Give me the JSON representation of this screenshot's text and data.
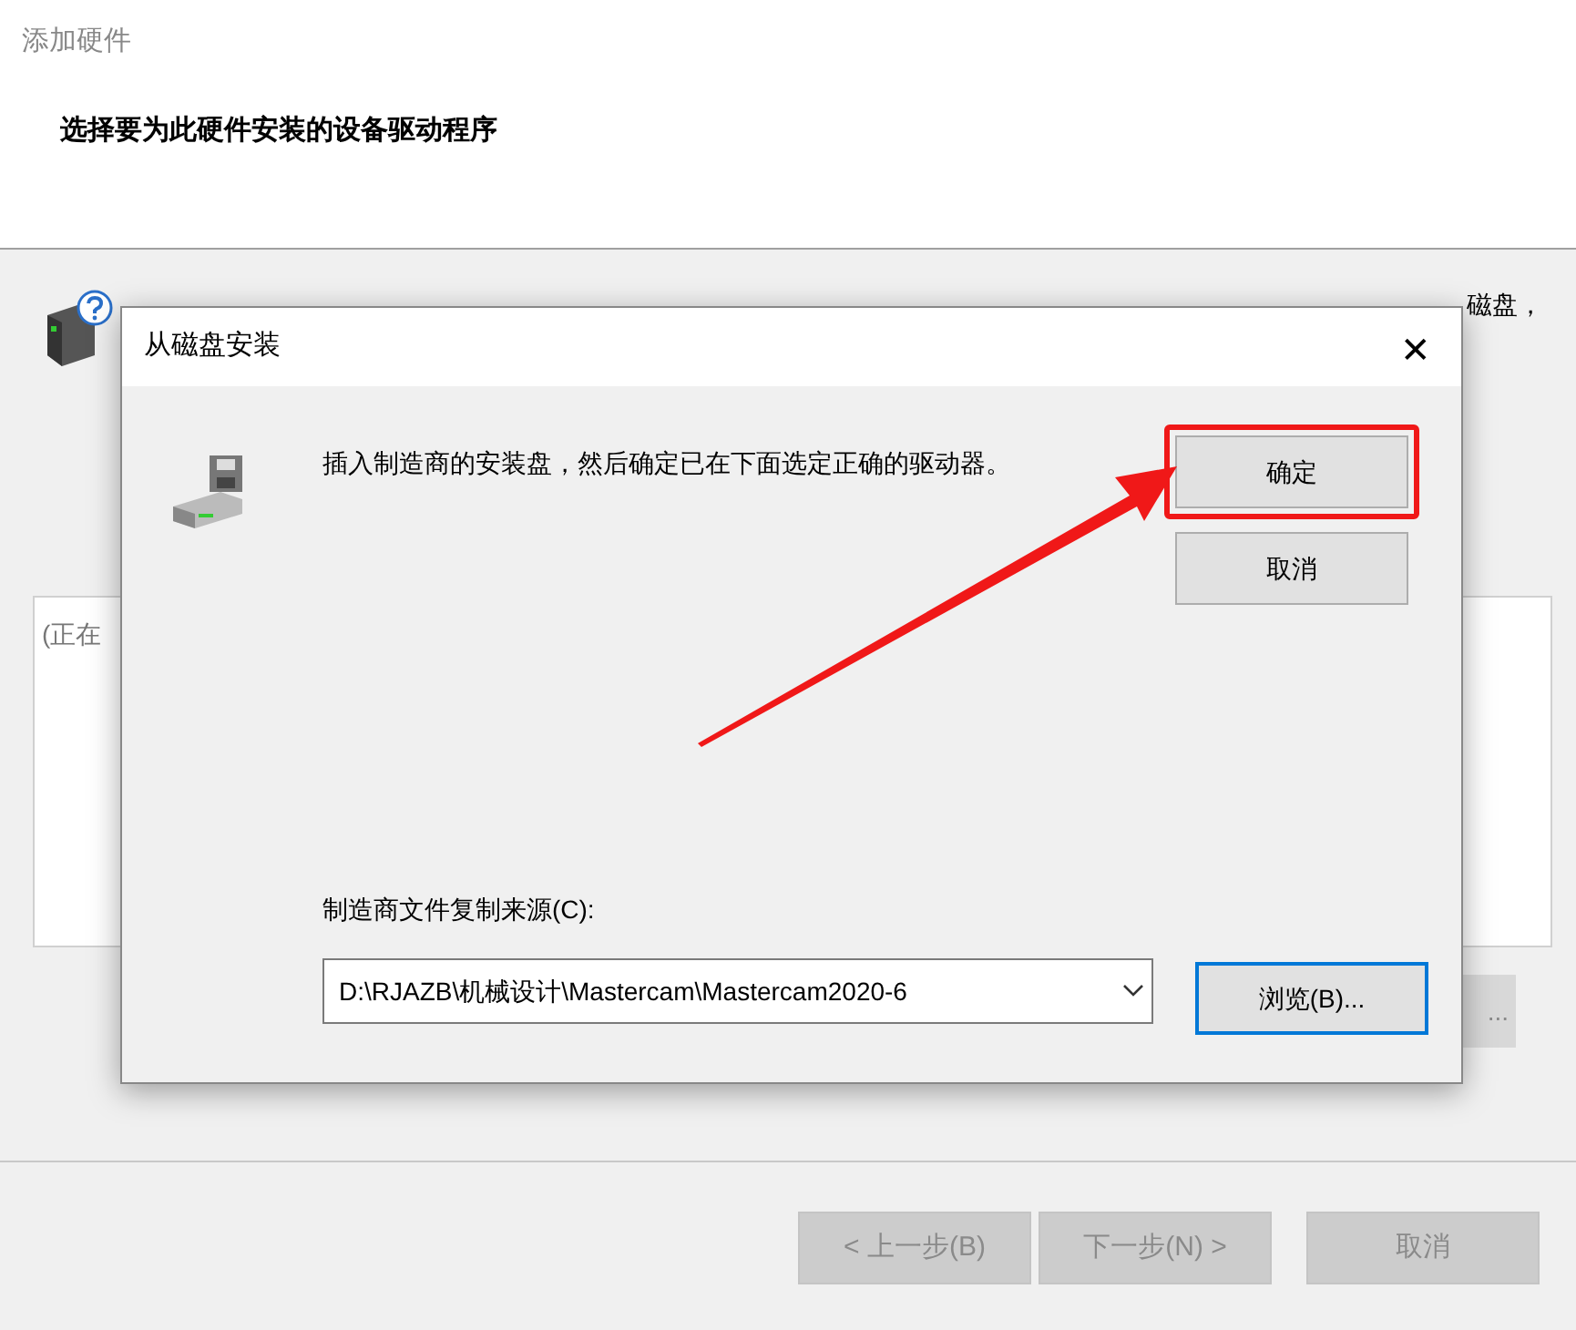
{
  "window": {
    "title": "添加硬件"
  },
  "heading": "选择要为此硬件安装的设备驱动程序",
  "intro_tail": "磁盘，",
  "list_text": "(正在",
  "partial_button": "...",
  "wizard_buttons": [
    {
      "label": "< 上一步(B)",
      "disabled": true
    },
    {
      "label": "下一步(N) >",
      "disabled": true
    },
    {
      "label": "取消",
      "disabled": true
    }
  ],
  "dialog": {
    "title": "从磁盘安装",
    "close": "✕",
    "message": "插入制造商的安装盘，然后确定已在下面选定正确的驱动器。",
    "buttons": [
      {
        "label": "确定",
        "highlighted": true
      },
      {
        "label": "取消",
        "highlighted": false
      }
    ],
    "source_label": "制造商文件复制来源(C):",
    "source_value": "D:\\RJAZB\\机械设计\\Mastercam\\Mastercam2020-6",
    "browse_button": {
      "label": "浏览(B)...",
      "focused": true
    }
  }
}
